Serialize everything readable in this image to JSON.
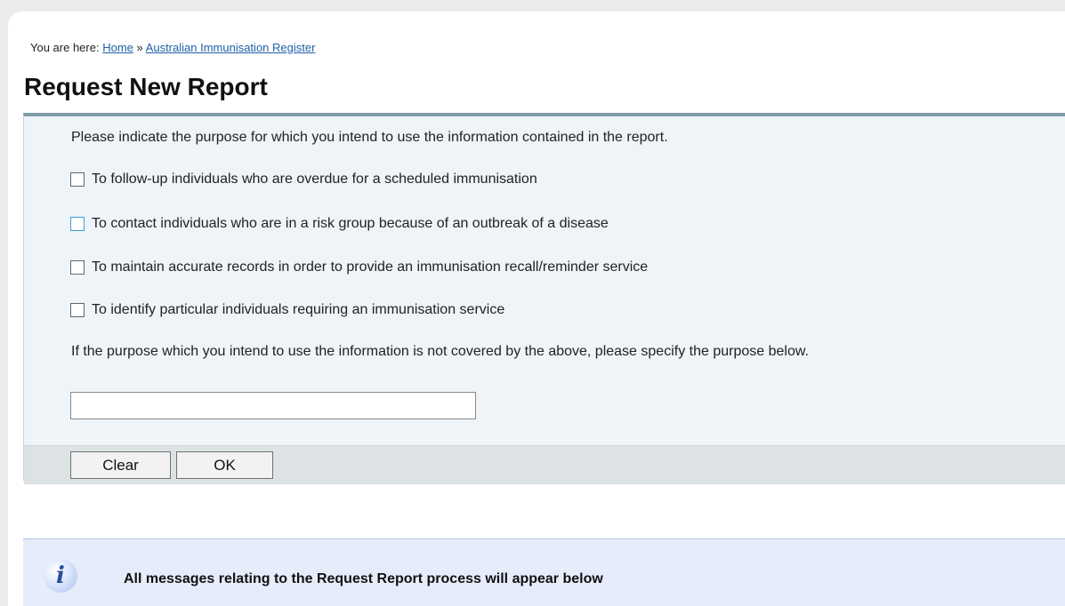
{
  "breadcrumb": {
    "prefix": "You are here:",
    "home": "Home",
    "separator": "»",
    "current": "Australian Immunisation Register"
  },
  "page_title": "Request New Report",
  "form": {
    "intro": "Please indicate the purpose for which you intend to use the information contained in the report.",
    "options": [
      {
        "label": "To follow-up individuals who are overdue for a scheduled immunisation",
        "checked": false
      },
      {
        "label": "To contact individuals who are in a risk group because of an outbreak of a disease",
        "checked": false
      },
      {
        "label": "To maintain accurate records in order to provide an immunisation recall/reminder service",
        "checked": false
      },
      {
        "label": "To identify particular individuals requiring an immunisation service",
        "checked": false
      }
    ],
    "other_label": "If the purpose which you intend to use the information is not covered by the above, please specify the purpose below.",
    "other_value": "",
    "buttons": {
      "clear": "Clear",
      "ok": "OK"
    }
  },
  "message": {
    "icon": "info-icon",
    "text": "All messages relating to the Request Report process will appear below"
  }
}
